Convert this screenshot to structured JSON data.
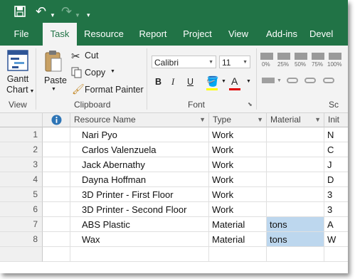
{
  "title_bar": {
    "qat_icons": [
      "save-icon",
      "undo-icon",
      "redo-icon",
      "customize-qat-icon"
    ]
  },
  "tabs": [
    {
      "label": "File",
      "active": false
    },
    {
      "label": "Task",
      "active": true
    },
    {
      "label": "Resource",
      "active": false
    },
    {
      "label": "Report",
      "active": false
    },
    {
      "label": "Project",
      "active": false
    },
    {
      "label": "View",
      "active": false
    },
    {
      "label": "Add-ins",
      "active": false
    },
    {
      "label": "Devel",
      "active": false
    }
  ],
  "ribbon": {
    "view_group": {
      "gantt_label_1": "Gantt",
      "gantt_label_2": "Chart",
      "group_label": "View"
    },
    "clipboard_group": {
      "paste": "Paste",
      "cut": "Cut",
      "copy": "Copy",
      "format_painter": "Format Painter",
      "group_label": "Clipboard"
    },
    "font_group": {
      "font_name": "Calibri",
      "font_size": "11",
      "bold": "B",
      "italic": "I",
      "underline": "U",
      "font_color_letter": "A",
      "group_label": "Font"
    },
    "schedule_group": {
      "percent_labels": [
        "0%",
        "25%",
        "50%",
        "75%",
        "100%"
      ],
      "group_label": "Sc"
    }
  },
  "grid": {
    "columns": [
      "Resource Name",
      "Type",
      "Material",
      "Init"
    ],
    "rows": [
      {
        "num": "1",
        "name": "Nari Pyo",
        "type": "Work",
        "material": "",
        "initials": "N"
      },
      {
        "num": "2",
        "name": "Carlos Valenzuela",
        "type": "Work",
        "material": "",
        "initials": "C"
      },
      {
        "num": "3",
        "name": "Jack Abernathy",
        "type": "Work",
        "material": "",
        "initials": "J"
      },
      {
        "num": "4",
        "name": "Dayna Hoffman",
        "type": "Work",
        "material": "",
        "initials": "D"
      },
      {
        "num": "5",
        "name": "3D Printer - First Floor",
        "type": "Work",
        "material": "",
        "initials": "3"
      },
      {
        "num": "6",
        "name": "3D Printer - Second Floor",
        "type": "Work",
        "material": "",
        "initials": "3"
      },
      {
        "num": "7",
        "name": "ABS Plastic",
        "type": "Material",
        "material": "tons",
        "initials": "A"
      },
      {
        "num": "8",
        "name": "Wax",
        "type": "Material",
        "material": "tons",
        "initials": "W"
      }
    ]
  },
  "colors": {
    "accent": "#217346",
    "selection": "#bdd7ee"
  }
}
